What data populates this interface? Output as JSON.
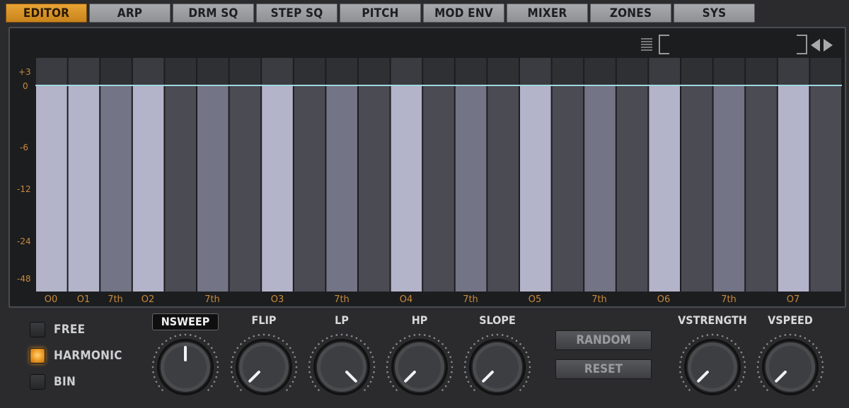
{
  "tabs": [
    {
      "label": "EDITOR",
      "active": true
    },
    {
      "label": "ARP",
      "active": false
    },
    {
      "label": "DRM SQ",
      "active": false
    },
    {
      "label": "STEP SQ",
      "active": false
    },
    {
      "label": "PITCH",
      "active": false
    },
    {
      "label": "MOD ENV",
      "active": false
    },
    {
      "label": "MIXER",
      "active": false
    },
    {
      "label": "ZONES",
      "active": false
    },
    {
      "label": "SYS",
      "active": false
    }
  ],
  "editor": {
    "db_ticks": [
      "+3",
      "0",
      "-6",
      "-12",
      "-24",
      "-48"
    ],
    "note_labels": [
      "O0",
      "O1",
      "7th",
      "O2",
      "7th",
      "O3",
      "7th",
      "O4",
      "7th",
      "O5",
      "7th",
      "O6",
      "7th",
      "O7"
    ],
    "bar_shades": [
      "light",
      "light",
      "mid",
      "light",
      "dark",
      "mid",
      "dark",
      "light",
      "dark",
      "mid",
      "dark",
      "light",
      "dark",
      "mid",
      "dark",
      "light",
      "dark",
      "mid",
      "dark",
      "light",
      "dark",
      "mid",
      "dark",
      "light",
      "dark"
    ],
    "bar_level_db": 0,
    "colors": {
      "light": "#b3b3c9",
      "mid": "#737485",
      "dark": "#4a4b53",
      "line": "#9fd8e0",
      "accent": "#e8a434"
    }
  },
  "modes": [
    {
      "label": "FREE",
      "on": false
    },
    {
      "label": "HARMONIC",
      "on": true
    },
    {
      "label": "BIN",
      "on": false
    }
  ],
  "knobs": [
    {
      "label": "NSWEEP",
      "value": 0.5
    },
    {
      "label": "FLIP",
      "value": 0.0
    },
    {
      "label": "LP",
      "value": 1.0
    },
    {
      "label": "HP",
      "value": 0.0
    },
    {
      "label": "SLOPE",
      "value": 0.0
    },
    {
      "label": "VSTRENGTH",
      "value": 0.0
    },
    {
      "label": "VSPEED",
      "value": 0.0
    }
  ],
  "buttons": {
    "random": "RANDOM",
    "reset": "RESET"
  }
}
